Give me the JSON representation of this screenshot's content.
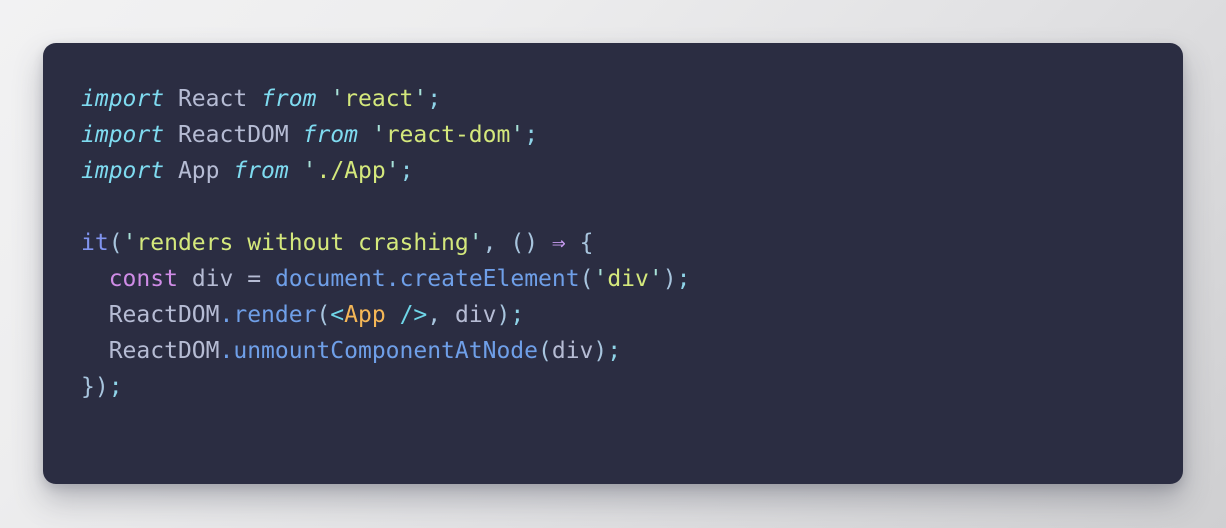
{
  "card": {
    "background_color": "#2b2d42",
    "corner_radius_px": 13,
    "language": "javascript"
  },
  "page": {
    "background_gradient_from": "#f2f2f3",
    "background_gradient_to": "#cfcfd1"
  },
  "code": {
    "font_size_px": 23,
    "line_height_px": 36,
    "raw_text": "import React from 'react';\nimport ReactDOM from 'react-dom';\nimport App from './App';\n\nit('renders without crashing', () => {\n  const div = document.createElement('div');\n  ReactDOM.render(<App />, div);\n  ReactDOM.unmountComponentAtNode(div);\n});",
    "lines": [
      {
        "index": 1,
        "text": "import React from 'react';",
        "tokens": [
          {
            "t": "import",
            "c": "keyword"
          },
          {
            "t": " ",
            "c": "plain"
          },
          {
            "t": "React",
            "c": "ident"
          },
          {
            "t": " ",
            "c": "plain"
          },
          {
            "t": "from",
            "c": "keyword"
          },
          {
            "t": " ",
            "c": "plain"
          },
          {
            "t": "'",
            "c": "quote"
          },
          {
            "t": "react",
            "c": "string"
          },
          {
            "t": "'",
            "c": "quote"
          },
          {
            "t": ";",
            "c": "semi"
          }
        ]
      },
      {
        "index": 2,
        "text": "import ReactDOM from 'react-dom';",
        "tokens": [
          {
            "t": "import",
            "c": "keyword"
          },
          {
            "t": " ",
            "c": "plain"
          },
          {
            "t": "ReactDOM",
            "c": "ident"
          },
          {
            "t": " ",
            "c": "plain"
          },
          {
            "t": "from",
            "c": "keyword"
          },
          {
            "t": " ",
            "c": "plain"
          },
          {
            "t": "'",
            "c": "quote"
          },
          {
            "t": "react-dom",
            "c": "string"
          },
          {
            "t": "'",
            "c": "quote"
          },
          {
            "t": ";",
            "c": "semi"
          }
        ]
      },
      {
        "index": 3,
        "text": "import App from './App';",
        "tokens": [
          {
            "t": "import",
            "c": "keyword"
          },
          {
            "t": " ",
            "c": "plain"
          },
          {
            "t": "App",
            "c": "ident"
          },
          {
            "t": " ",
            "c": "plain"
          },
          {
            "t": "from",
            "c": "keyword"
          },
          {
            "t": " ",
            "c": "plain"
          },
          {
            "t": "'",
            "c": "quote"
          },
          {
            "t": "./App",
            "c": "string"
          },
          {
            "t": "'",
            "c": "quote"
          },
          {
            "t": ";",
            "c": "semi"
          }
        ]
      },
      {
        "index": 4,
        "text": "",
        "tokens": []
      },
      {
        "index": 5,
        "text": "it('renders without crashing', () => {",
        "tokens": [
          {
            "t": "it",
            "c": "func"
          },
          {
            "t": "(",
            "c": "punct"
          },
          {
            "t": "'",
            "c": "quote"
          },
          {
            "t": "renders without crashing",
            "c": "string"
          },
          {
            "t": "'",
            "c": "quote"
          },
          {
            "t": ",",
            "c": "punct"
          },
          {
            "t": " ",
            "c": "plain"
          },
          {
            "t": "()",
            "c": "punct"
          },
          {
            "t": " ",
            "c": "plain"
          },
          {
            "t": "⇒",
            "c": "arrow"
          },
          {
            "t": " ",
            "c": "plain"
          },
          {
            "t": "{",
            "c": "punct"
          }
        ]
      },
      {
        "index": 6,
        "text": "  const div = document.createElement('div');",
        "tokens": [
          {
            "t": "  ",
            "c": "plain"
          },
          {
            "t": "const",
            "c": "declare"
          },
          {
            "t": " ",
            "c": "plain"
          },
          {
            "t": "div",
            "c": "ident"
          },
          {
            "t": " ",
            "c": "plain"
          },
          {
            "t": "=",
            "c": "operator"
          },
          {
            "t": " ",
            "c": "plain"
          },
          {
            "t": "document",
            "c": "property"
          },
          {
            "t": ".",
            "c": "dot"
          },
          {
            "t": "createElement",
            "c": "property"
          },
          {
            "t": "(",
            "c": "punct"
          },
          {
            "t": "'",
            "c": "quote"
          },
          {
            "t": "div",
            "c": "string"
          },
          {
            "t": "'",
            "c": "quote"
          },
          {
            "t": ")",
            "c": "punct"
          },
          {
            "t": ";",
            "c": "semi"
          }
        ]
      },
      {
        "index": 7,
        "text": "  ReactDOM.render(<App />, div);",
        "tokens": [
          {
            "t": "  ",
            "c": "plain"
          },
          {
            "t": "ReactDOM",
            "c": "ident"
          },
          {
            "t": ".",
            "c": "dot"
          },
          {
            "t": "render",
            "c": "property"
          },
          {
            "t": "(",
            "c": "punct"
          },
          {
            "t": "<",
            "c": "bracket"
          },
          {
            "t": "App",
            "c": "tag"
          },
          {
            "t": " ",
            "c": "plain"
          },
          {
            "t": "/>",
            "c": "bracket"
          },
          {
            "t": ",",
            "c": "punct"
          },
          {
            "t": " ",
            "c": "plain"
          },
          {
            "t": "div",
            "c": "ident"
          },
          {
            "t": ")",
            "c": "punct"
          },
          {
            "t": ";",
            "c": "semi"
          }
        ]
      },
      {
        "index": 8,
        "text": "  ReactDOM.unmountComponentAtNode(div);",
        "tokens": [
          {
            "t": "  ",
            "c": "plain"
          },
          {
            "t": "ReactDOM",
            "c": "ident"
          },
          {
            "t": ".",
            "c": "dot"
          },
          {
            "t": "unmountComponentAtNode",
            "c": "property"
          },
          {
            "t": "(",
            "c": "punct"
          },
          {
            "t": "div",
            "c": "ident"
          },
          {
            "t": ")",
            "c": "punct"
          },
          {
            "t": ";",
            "c": "semi"
          }
        ]
      },
      {
        "index": 9,
        "text": "});",
        "tokens": [
          {
            "t": "})",
            "c": "punct"
          },
          {
            "t": ";",
            "c": "semi"
          }
        ]
      }
    ]
  },
  "theme": {
    "keyword": "#7fdbf0",
    "ident": "#b6bcd4",
    "string": "#d4e87c",
    "quote": "#a8e2d8",
    "punct": "#a8c5de",
    "semi": "#8fd4e8",
    "func": "#8094ef",
    "declare": "#cf8ce6",
    "operator": "#b6bcd4",
    "property": "#6f9fe8",
    "arrow": "#c79bf0",
    "tag": "#f5b757",
    "bracket": "#6fd6e8",
    "dot": "#6f9fe8",
    "plain": "#c4c8d6"
  }
}
